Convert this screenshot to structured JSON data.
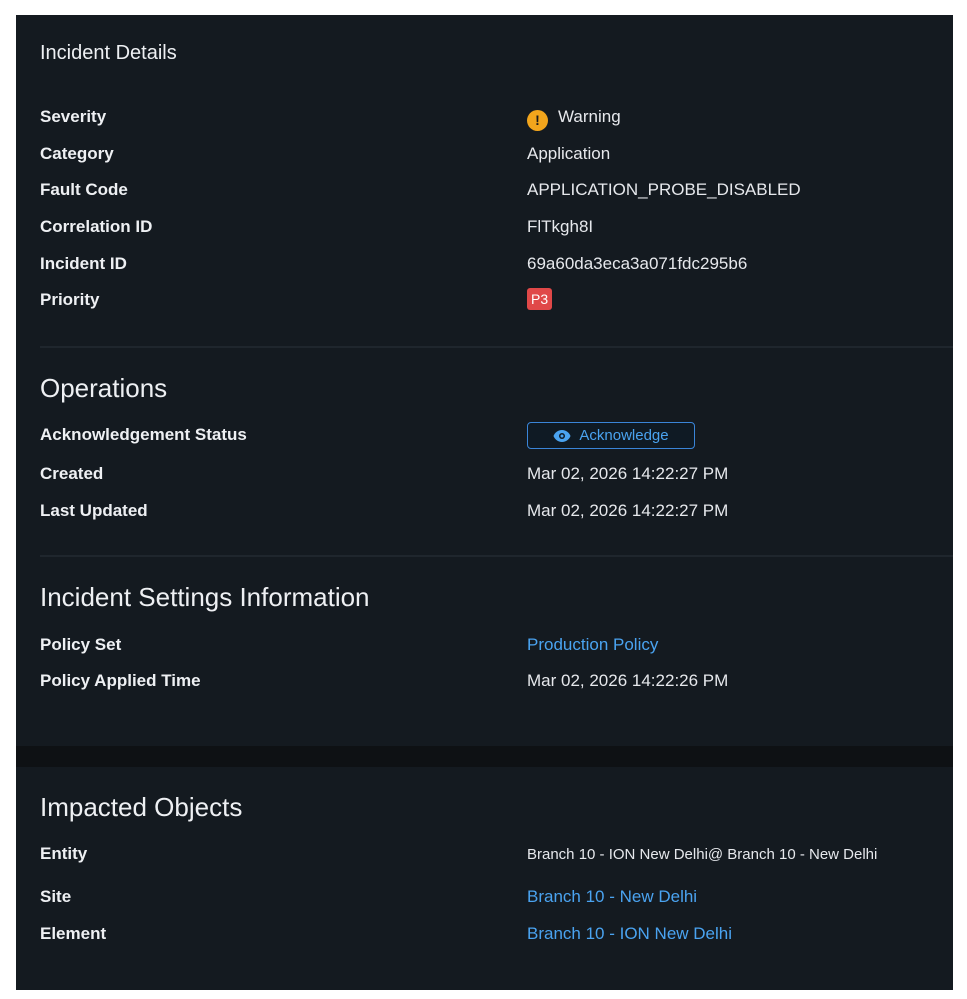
{
  "incident_details": {
    "title": "Incident Details",
    "rows": {
      "severity": {
        "label": "Severity",
        "value": "Warning",
        "icon": "warning-icon",
        "icon_color": "#f2a51c"
      },
      "category": {
        "label": "Category",
        "value": "Application"
      },
      "fault_code": {
        "label": "Fault Code",
        "value": "APPLICATION_PROBE_DISABLED"
      },
      "correlation_id": {
        "label": "Correlation ID",
        "value": "FlTkgh8I"
      },
      "incident_id": {
        "label": "Incident ID",
        "value": "69a60da3eca3a071fdc295b6"
      },
      "priority": {
        "label": "Priority",
        "value": "P3",
        "badge_color": "#e04848"
      }
    }
  },
  "operations": {
    "title": "Operations",
    "rows": {
      "ack_status": {
        "label": "Acknowledgement Status",
        "button_label": "Acknowledge",
        "icon": "eye-icon"
      },
      "created": {
        "label": "Created",
        "value": "Mar 02, 2026 14:22:27 PM"
      },
      "last_updated": {
        "label": "Last Updated",
        "value": "Mar 02, 2026 14:22:27 PM"
      }
    }
  },
  "settings": {
    "title": "Incident Settings Information",
    "rows": {
      "policy_set": {
        "label": "Policy Set",
        "value": "Production Policy"
      },
      "policy_applied": {
        "label": "Policy Applied Time",
        "value": "Mar 02, 2026 14:22:26 PM"
      }
    }
  },
  "impacted": {
    "title": "Impacted Objects",
    "rows": {
      "entity": {
        "label": "Entity",
        "value": "Branch 10 - ION New Delhi@ Branch 10 - New Delhi"
      },
      "site": {
        "label": "Site",
        "value": "Branch 10 - New Delhi"
      },
      "element": {
        "label": "Element",
        "value": "Branch 10 - ION New Delhi"
      }
    }
  },
  "colors": {
    "background": "#141a20",
    "link": "#4aa3f0",
    "warning": "#f2a51c",
    "priority_badge": "#e04848"
  }
}
